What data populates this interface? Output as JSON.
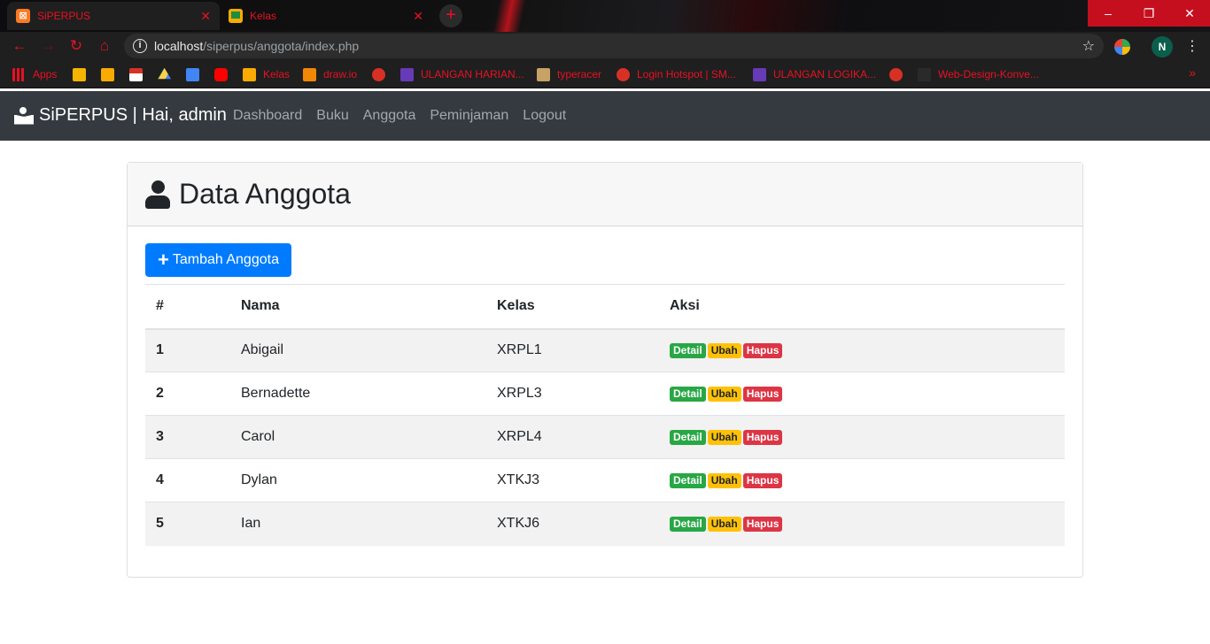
{
  "browser": {
    "tabs": [
      {
        "title": "SiPERPUS",
        "active": true
      },
      {
        "title": "Kelas",
        "active": false
      }
    ],
    "new_tab_symbol": "+",
    "url_host": "localhost",
    "url_path": "/siperpus/anggota/index.php",
    "profile_initial": "N",
    "bookmarks": [
      "Apps",
      "",
      "",
      "",
      "",
      "",
      "",
      "Kelas",
      "draw.io",
      "",
      "ULANGAN HARIAN...",
      "typeracer",
      "Login Hotspot | SM...",
      "ULANGAN LOGIKA...",
      "",
      "Web-Design-Konve..."
    ],
    "accent_color": "#e81123"
  },
  "navbar": {
    "brand": "SiPERPUS | Hai, admin",
    "links": [
      "Dashboard",
      "Buku",
      "Anggota",
      "Peminjaman",
      "Logout"
    ]
  },
  "page": {
    "title": "Data Anggota",
    "add_button": "Tambah Anggota"
  },
  "table": {
    "headers": [
      "#",
      "Nama",
      "Kelas",
      "Aksi"
    ],
    "rows": [
      {
        "num": "1",
        "nama": "Abigail",
        "kelas": "XRPL1"
      },
      {
        "num": "2",
        "nama": "Bernadette",
        "kelas": "XRPL3"
      },
      {
        "num": "3",
        "nama": "Carol",
        "kelas": "XRPL4"
      },
      {
        "num": "4",
        "nama": "Dylan",
        "kelas": "XTKJ3"
      },
      {
        "num": "5",
        "nama": "Ian",
        "kelas": "XTKJ6"
      }
    ],
    "actions": [
      "Detail",
      "Ubah",
      "Hapus"
    ]
  }
}
